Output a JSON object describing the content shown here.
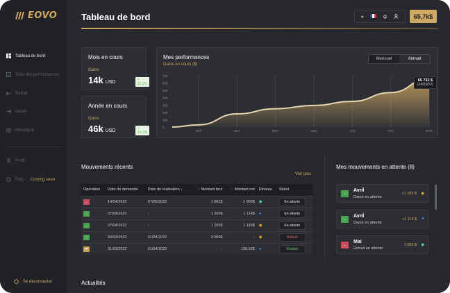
{
  "app": {
    "brand": "EOVO"
  },
  "sidebar": {
    "items": [
      {
        "label": "Tableau de bord"
      },
      {
        "label": "Suivi des performances"
      },
      {
        "label": "Retrait"
      },
      {
        "label": "Dépôt"
      },
      {
        "label": "Historique"
      }
    ],
    "profile_label": "Profil",
    "faq_label": "FAQ -",
    "coming_soon": "Coming soon",
    "logout_label": "Se déconnecter"
  },
  "header": {
    "title": "Tableau de bord",
    "balance": "65,7k$"
  },
  "kpis": {
    "month": {
      "title": "Mois en cours",
      "gains_label": "Gains",
      "value": "14k",
      "unit": "USD",
      "pct": "+ 21,2%"
    },
    "year": {
      "title": "Année en cours",
      "gains_label": "Gains",
      "value": "46k",
      "unit": "USD",
      "pct": "+ 14,2%"
    }
  },
  "performance": {
    "title": "Mes performances",
    "subtitle": "Gains en cours ($)",
    "toggle": [
      "Mensuel",
      "Annuel"
    ],
    "tooltip_value": "65 732 $",
    "tooltip_date": "(24/03/22)"
  },
  "chart_data": {
    "type": "area",
    "categories": [
      "SEP",
      "OCT",
      "NOV",
      "DEC",
      "JAN",
      "FEV",
      "MAR"
    ],
    "y_ticks": [
      "0",
      "10k",
      "20k",
      "30k",
      "40k",
      "50k",
      "60k",
      "70k"
    ],
    "ylim": [
      0,
      70000
    ],
    "values": [
      3000,
      18000,
      25000,
      29500,
      35000,
      47000,
      65732
    ],
    "grid": true,
    "accent": "#cfa863"
  },
  "movements": {
    "title": "Mouvements récents",
    "see_more": "Voir plus",
    "columns": [
      "Opération",
      "Date de demande",
      "Date de réalisation ↓",
      "Montant brut",
      "Montant net",
      "Réseau",
      "Statut"
    ],
    "rows": [
      {
        "op": "withdraw",
        "date_req": "14/04/2022",
        "date_done": "07/05/2022",
        "brut": "1 081$",
        "net": "1 000$",
        "network": "diamond",
        "status": "En attente"
      },
      {
        "op": "deposit",
        "date_req": "07/04/2022",
        "date_done": "-",
        "brut": "1 200$",
        "net": "1 114$",
        "network": "circle",
        "status": "En attente"
      },
      {
        "op": "deposit",
        "date_req": "07/04/2022",
        "date_done": "-",
        "brut": "1 200$",
        "net": "1 189$",
        "network": "binance",
        "status": "En attente"
      },
      {
        "op": "deposit",
        "date_req": "30/03/2022",
        "date_done": "01/04/2022",
        "brut": "3 000$",
        "net": "-",
        "network": "binance",
        "status": "Refusé"
      },
      {
        "op": "gold",
        "date_req": "31/03/2022",
        "date_done": "01/04/2022",
        "brut": "-",
        "net": "120,56$",
        "network": "circle",
        "status": "Réalisé"
      }
    ]
  },
  "pending": {
    "title": "Mes mouvements en attente (8)",
    "items": [
      {
        "month": "Avril",
        "desc": "Depot en attente",
        "amount": "+1 189 $"
      },
      {
        "month": "Avril",
        "desc": "Depot en attente",
        "amount": "+1 114 $"
      },
      {
        "month": "Mai",
        "desc": "Retrait en attente",
        "amount": "1 000 $"
      }
    ]
  },
  "news": {
    "title": "Actualités"
  },
  "colors": {
    "accent": "#cfa863",
    "bg": "#202226",
    "panel": "#2c2e33",
    "deposit": "#4aa34e",
    "withdraw": "#c94c5c"
  }
}
